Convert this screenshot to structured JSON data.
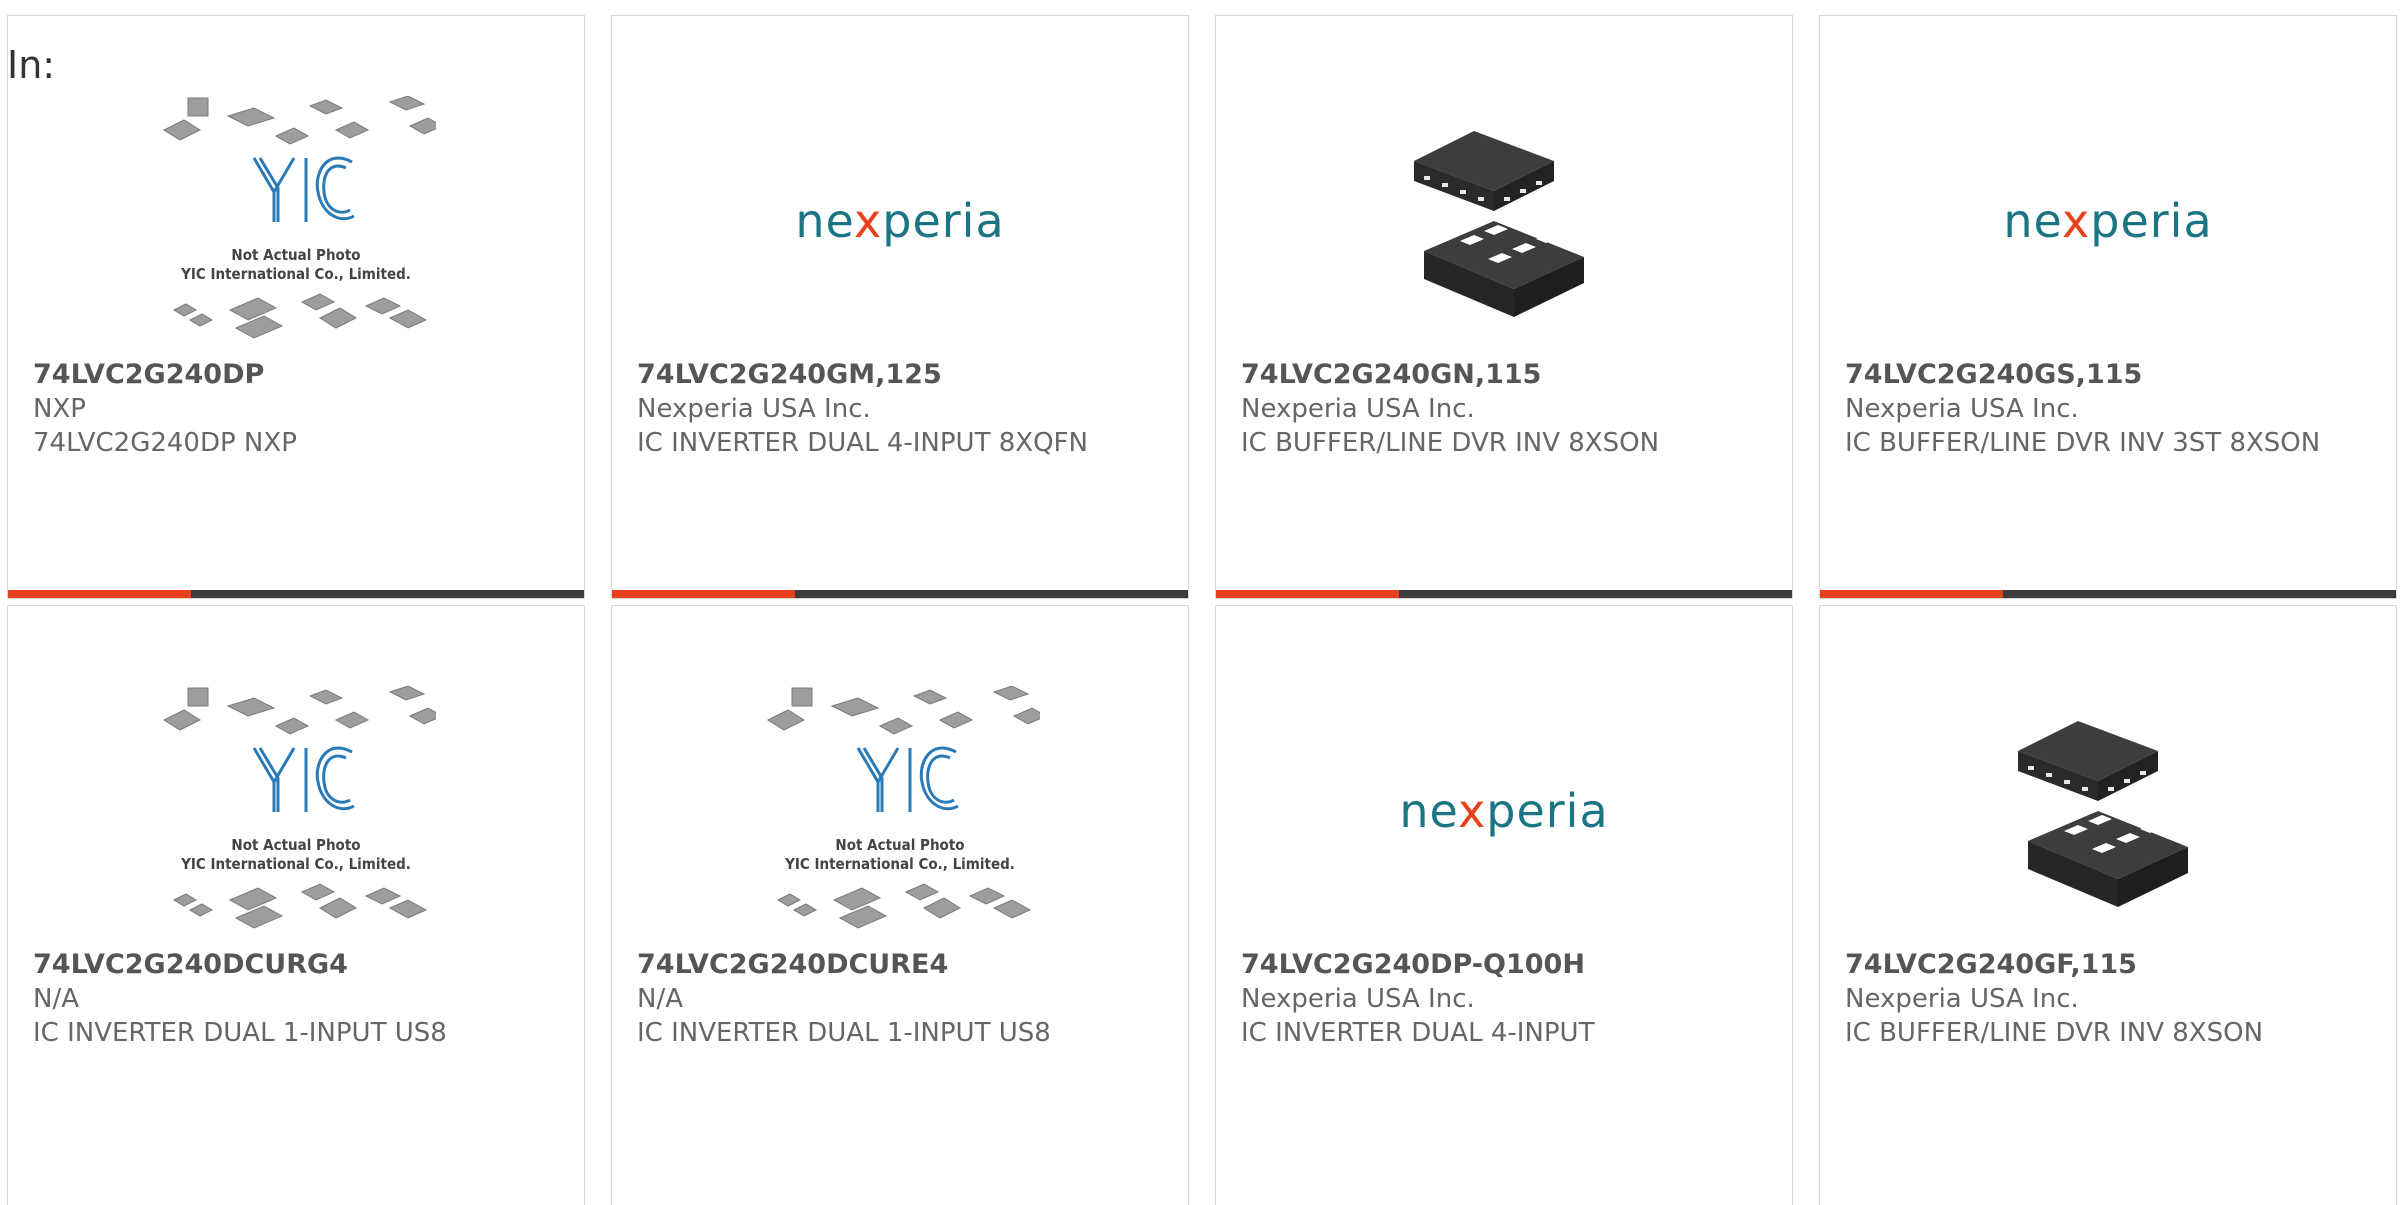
{
  "filter_label": "In:",
  "products": [
    {
      "part": "74LVC2G240DP",
      "manufacturer": "NXP",
      "description": "74LVC2G240DP NXP",
      "image": "yic-placeholder-icon"
    },
    {
      "part": "74LVC2G240GM,125",
      "manufacturer": "Nexperia USA Inc.",
      "description": "IC INVERTER DUAL 4-INPUT 8XQFN",
      "image": "nexperia-logo"
    },
    {
      "part": "74LVC2G240GN,115",
      "manufacturer": "Nexperia USA Inc.",
      "description": "IC BUFFER/LINE DVR INV 8XSON",
      "image": "chip-xson-icon"
    },
    {
      "part": "74LVC2G240GS,115",
      "manufacturer": "Nexperia USA Inc.",
      "description": "IC BUFFER/LINE DVR INV 3ST 8XSON",
      "image": "nexperia-logo"
    },
    {
      "part": "74LVC2G240DCURG4",
      "manufacturer": "N/A",
      "description": "IC INVERTER DUAL 1-INPUT US8",
      "image": "yic-placeholder-icon"
    },
    {
      "part": "74LVC2G240DCURE4",
      "manufacturer": "N/A",
      "description": "IC INVERTER DUAL 1-INPUT US8",
      "image": "yic-placeholder-icon"
    },
    {
      "part": "74LVC2G240DP-Q100H",
      "manufacturer": "Nexperia USA Inc.",
      "description": "IC INVERTER DUAL 4-INPUT",
      "image": "nexperia-logo"
    },
    {
      "part": "74LVC2G240GF,115",
      "manufacturer": "Nexperia USA Inc.",
      "description": "IC BUFFER/LINE DVR INV 8XSON",
      "image": "chip-xson-icon"
    }
  ],
  "placeholder": {
    "line1": "Not Actual Photo",
    "line2": "YIC International Co., Limited."
  },
  "nexperia_logo": {
    "left": "ne",
    "x": "x",
    "right": "peria"
  },
  "colors": {
    "accent": "#e8401c",
    "bar": "#3d3d3d",
    "nexperia_teal": "#1c7583"
  }
}
